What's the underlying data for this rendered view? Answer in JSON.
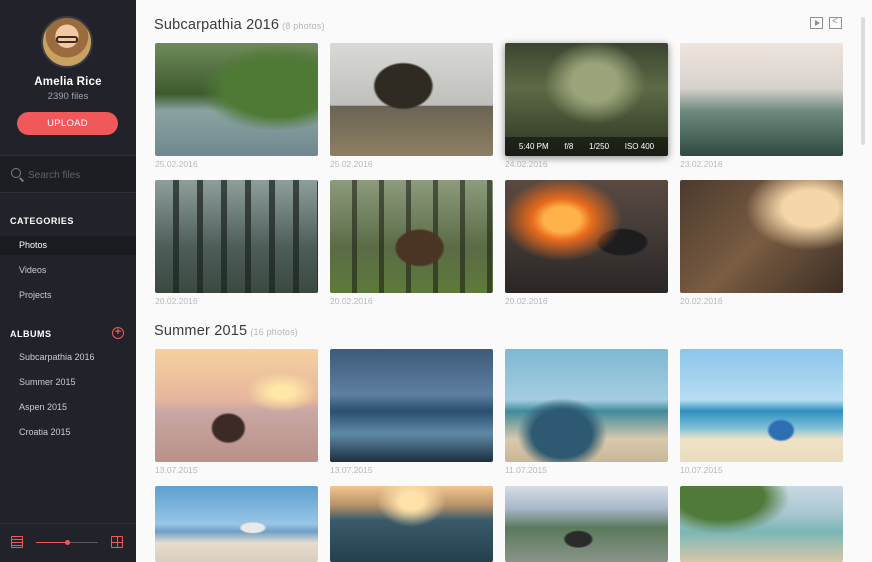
{
  "user": {
    "name": "Amelia Rice",
    "files": "2390 files"
  },
  "upload_label": "UPLOAD",
  "search": {
    "placeholder": "Search files"
  },
  "categories": {
    "title": "CATEGORIES",
    "items": [
      {
        "label": "Photos",
        "active": true
      },
      {
        "label": "Videos"
      },
      {
        "label": "Projects"
      }
    ]
  },
  "albums": {
    "title": "ALBUMS",
    "items": [
      {
        "label": "Subcarpathia 2016"
      },
      {
        "label": "Summer 2015"
      },
      {
        "label": "Aspen 2015"
      },
      {
        "label": "Croatia 2015"
      }
    ]
  },
  "zoom": {
    "level": 0.5
  },
  "colors": {
    "accent": "#f0585a",
    "sidebar": "#22232a"
  },
  "sections": [
    {
      "title": "Subcarpathia 2016",
      "count": "(8 photos)",
      "rows": [
        [
          {
            "date": "25.02.2016",
            "scene": "deer"
          },
          {
            "date": "25.02.2016",
            "scene": "tree-road"
          },
          {
            "date": "24.02.2016",
            "scene": "misty-valley",
            "selected": true,
            "exif": {
              "time": "5:40 PM",
              "aperture": "f/8",
              "shutter": "1/250",
              "iso": "ISO 400"
            }
          },
          {
            "date": "23.02.2016",
            "scene": "foggy-forest"
          }
        ],
        [
          {
            "date": "20.02.2016",
            "scene": "dark-forest"
          },
          {
            "date": "20.02.2016",
            "scene": "cabin"
          },
          {
            "date": "20.02.2016",
            "scene": "campfire-cup"
          },
          {
            "date": "20.02.2016",
            "scene": "kitchen"
          }
        ]
      ]
    },
    {
      "title": "Summer 2015",
      "count": "(16 photos)",
      "rows": [
        [
          {
            "date": "13.07.2015",
            "scene": "sunset-girl"
          },
          {
            "date": "13.07.2015",
            "scene": "ocean-dusk"
          },
          {
            "date": "11.07.2015",
            "scene": "beach-arm"
          },
          {
            "date": "10.07.2015",
            "scene": "boat-beach"
          }
        ],
        [
          {
            "date": "",
            "scene": "lifeguard"
          },
          {
            "date": "",
            "scene": "sunset-sea"
          },
          {
            "date": "",
            "scene": "hiker-town"
          },
          {
            "date": "",
            "scene": "lagoon"
          }
        ]
      ]
    }
  ]
}
